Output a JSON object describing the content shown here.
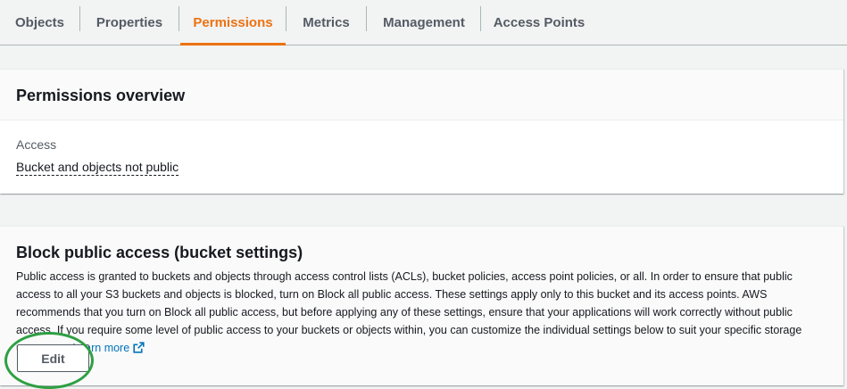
{
  "tabs": [
    {
      "label": "Objects"
    },
    {
      "label": "Properties"
    },
    {
      "label": "Permissions",
      "active": true
    },
    {
      "label": "Metrics"
    },
    {
      "label": "Management"
    },
    {
      "label": "Access Points"
    }
  ],
  "permissions_overview": {
    "title": "Permissions overview",
    "access_label": "Access",
    "access_value": "Bucket and objects not public"
  },
  "block_public_access": {
    "title": "Block public access (bucket settings)",
    "description": "Public access is granted to buckets and objects through access control lists (ACLs), bucket policies, access point policies, or all. In order to ensure that public access to all your S3 buckets and objects is blocked, turn on Block all public access. These settings apply only to this bucket and its access points. AWS recommends that you turn on Block all public access, but before applying any of these settings, ensure that your applications will work correctly without public access. If you require some level of public access to your buckets or objects within, you can customize the individual settings below to suit your specific storage use cases.",
    "learn_more": "Learn more",
    "edit_label": "Edit"
  },
  "colors": {
    "accent": "#ec7211",
    "link": "#0073bb",
    "annotation": "#2ea043"
  },
  "icons": {
    "learn_more": "external-link-icon"
  }
}
